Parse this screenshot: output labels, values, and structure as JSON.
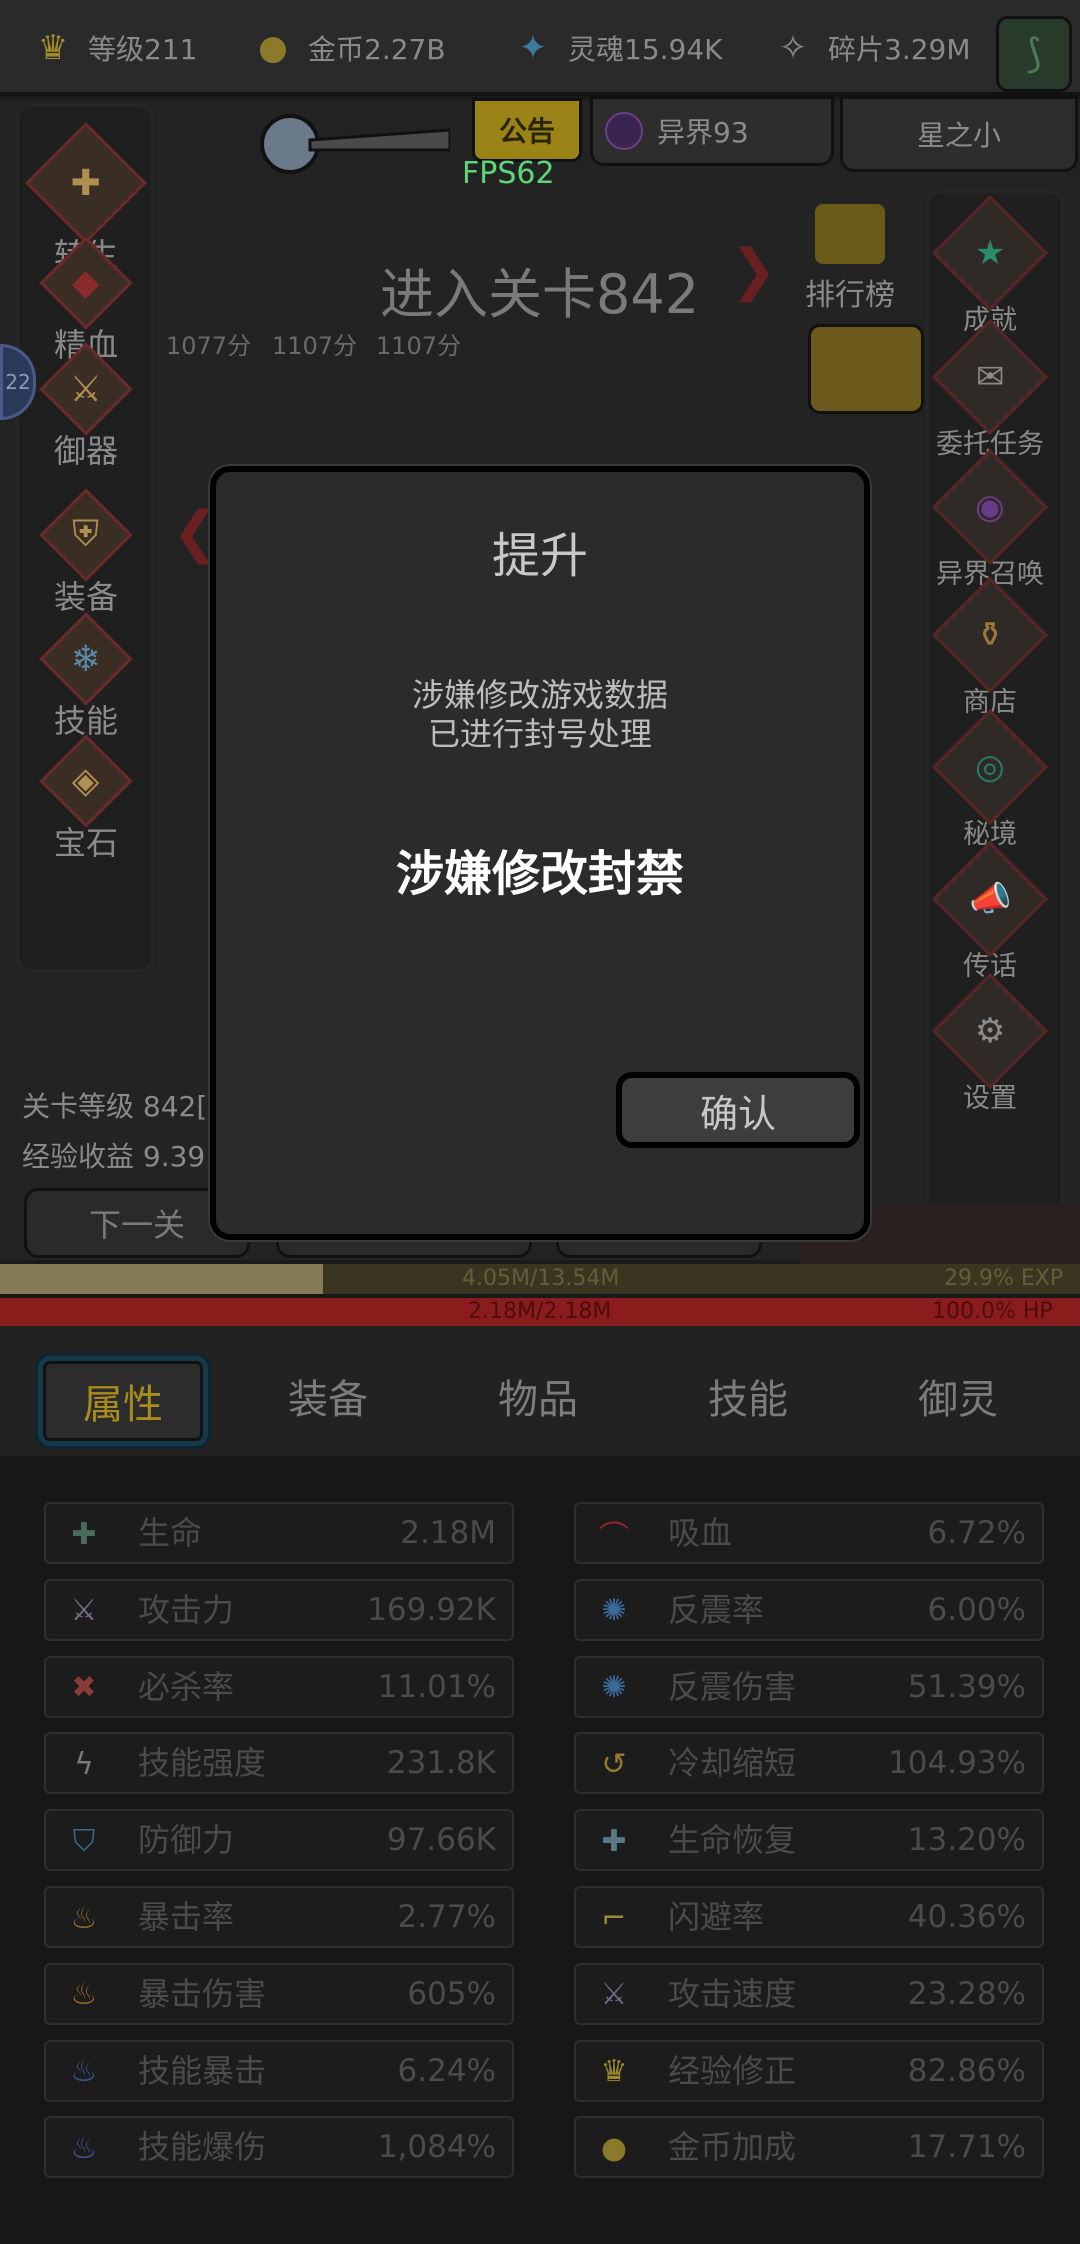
{
  "topbar": {
    "resources": [
      {
        "icon": "crown-icon",
        "glyph": "♛",
        "color": "#a08a2a",
        "label": "等级211"
      },
      {
        "icon": "coin-icon",
        "glyph": "●",
        "color": "#8a7a2a",
        "label": "金币2.27B"
      },
      {
        "icon": "soul-icon",
        "glyph": "✦",
        "color": "#3a7a9a",
        "label": "灵魂15.94K"
      },
      {
        "icon": "shard-icon",
        "glyph": "✧",
        "color": "#8a8a8a",
        "label": "碎片3.29M"
      }
    ]
  },
  "header": {
    "notice_label": "公告",
    "fps": "FPS62",
    "otherworld_label": "异界93",
    "username": "星之小"
  },
  "scene": {
    "left_menu": [
      {
        "id": "rebirth",
        "label": "转生",
        "glyph": "✚"
      },
      {
        "id": "essence",
        "label": "精血",
        "glyph": "◆"
      },
      {
        "id": "weapon",
        "label": "御器",
        "glyph": "⚔"
      },
      {
        "id": "equip",
        "label": "装备",
        "glyph": "⛨"
      },
      {
        "id": "skill",
        "label": "技能",
        "glyph": "❄"
      },
      {
        "id": "gem",
        "label": "宝石",
        "glyph": "◈"
      }
    ],
    "right_menu": [
      {
        "id": "achievement",
        "label": "成就",
        "glyph": "★",
        "color": "#2a8a6a"
      },
      {
        "id": "commission",
        "label": "委托任务",
        "glyph": "✉",
        "color": "#8a8a8a"
      },
      {
        "id": "summon",
        "label": "异界召唤",
        "glyph": "◉",
        "color": "#6a3a8a"
      },
      {
        "id": "shop",
        "label": "商店",
        "glyph": "⚱",
        "color": "#9a7a3a"
      },
      {
        "id": "secret",
        "label": "秘境",
        "glyph": "◎",
        "color": "#2a7a6a"
      },
      {
        "id": "message",
        "label": "传话",
        "glyph": "📣",
        "color": "#3a8a4a"
      },
      {
        "id": "settings",
        "label": "设置",
        "glyph": "⚙",
        "color": "#8a8a8a"
      }
    ],
    "leaderboard_label": "排行榜",
    "stage_title": "进入关卡842",
    "scores": [
      "1077分",
      "1107分",
      "1107分"
    ],
    "level_line": "关卡等级 842[",
    "exp_line": "经验收益 9.39",
    "next_stage_label": "下一关"
  },
  "bars": {
    "exp_text": "4.05M/13.54M",
    "exp_percent": "29.9% EXP",
    "exp_fraction": 0.299,
    "hp_text": "2.18M/2.18M",
    "hp_percent": "100.0%   HP",
    "hp_fraction": 1.0
  },
  "tabs": [
    {
      "label": "属性",
      "active": true
    },
    {
      "label": "装备",
      "active": false
    },
    {
      "label": "物品",
      "active": false
    },
    {
      "label": "技能",
      "active": false
    },
    {
      "label": "御灵",
      "active": false
    }
  ],
  "stats": {
    "left": [
      {
        "name": "生命",
        "value": "2.18M",
        "icon": "life-icon",
        "glyph": "✚",
        "color": "#4a6a5a"
      },
      {
        "name": "攻击力",
        "value": "169.92K",
        "icon": "sword-icon",
        "glyph": "⚔",
        "color": "#7a6a8a"
      },
      {
        "name": "必杀率",
        "value": "11.01%",
        "icon": "critical-kill-icon",
        "glyph": "✖",
        "color": "#8a3a3a"
      },
      {
        "name": "技能强度",
        "value": "231.8K",
        "icon": "lightning-icon",
        "glyph": "ϟ",
        "color": "#7a7a7a"
      },
      {
        "name": "防御力",
        "value": "97.66K",
        "icon": "shield-icon",
        "glyph": "⛉",
        "color": "#3a6a8a"
      },
      {
        "name": "暴击率",
        "value": "2.77%",
        "icon": "flame-icon",
        "glyph": "♨",
        "color": "#9a6a2a"
      },
      {
        "name": "暴击伤害",
        "value": "605%",
        "icon": "flame-icon",
        "glyph": "♨",
        "color": "#9a6a2a"
      },
      {
        "name": "技能暴击",
        "value": "6.24%",
        "icon": "blue-flame-icon",
        "glyph": "♨",
        "color": "#3a5a9a"
      },
      {
        "name": "技能爆伤",
        "value": "1,084%",
        "icon": "blue-flame-icon",
        "glyph": "♨",
        "color": "#3a5a9a"
      }
    ],
    "right": [
      {
        "name": "吸血",
        "value": "6.72%",
        "icon": "bat-icon",
        "glyph": "⌒",
        "color": "#8a2a2a"
      },
      {
        "name": "反震率",
        "value": "6.00%",
        "icon": "shatter-icon",
        "glyph": "✺",
        "color": "#3a6a9a"
      },
      {
        "name": "反震伤害",
        "value": "51.39%",
        "icon": "shatter-icon",
        "glyph": "✺",
        "color": "#3a6a9a"
      },
      {
        "name": "冷却缩短",
        "value": "104.93%",
        "icon": "cooldown-icon",
        "glyph": "↺",
        "color": "#9a7a2a"
      },
      {
        "name": "生命恢复",
        "value": "13.20%",
        "icon": "regen-icon",
        "glyph": "✚",
        "color": "#5a7a8a"
      },
      {
        "name": "闪避率",
        "value": "40.36%",
        "icon": "boot-icon",
        "glyph": "⌐",
        "color": "#9a8a3a"
      },
      {
        "name": "攻击速度",
        "value": "23.28%",
        "icon": "swords-icon",
        "glyph": "⚔",
        "color": "#6a6a8a"
      },
      {
        "name": "经验修正",
        "value": "82.86%",
        "icon": "crown-icon",
        "glyph": "♛",
        "color": "#9a8a2a"
      },
      {
        "name": "金币加成",
        "value": "17.71%",
        "icon": "coin-icon",
        "glyph": "●",
        "color": "#8a7a2a"
      }
    ]
  },
  "modal": {
    "title": "提升",
    "message_lines": [
      "涉嫌修改游戏数据",
      "已进行封号处理"
    ],
    "ban_text": "涉嫌修改封禁",
    "confirm_label": "确认"
  }
}
